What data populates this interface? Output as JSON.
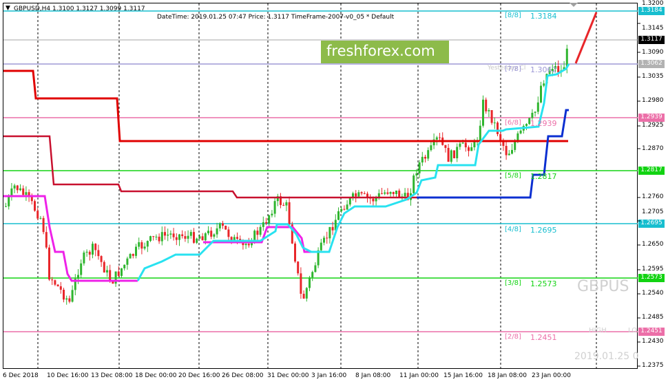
{
  "header": {
    "symbol_line": "GBPUSD,H4  1.3100 1.3127 1.3099 1.3117",
    "info_line": "DateTime: 2019.01.25 07:47    Price: 1.3117    TimeFrame-2007-v0_05    *    Default",
    "watermark": "freshforex.com",
    "pair_watermark": "GBPUS",
    "bottom_datetime": "2019.01.25 0",
    "high_label": "HIGH",
    "low_label": "LO",
    "yesterday_label": "Yesterday Cl"
  },
  "price_axis": {
    "ticks": [
      "1.3200",
      "1.3145",
      "1.3090",
      "1.3035",
      "1.2980",
      "1.2925",
      "1.2870",
      "1.2760",
      "1.2705",
      "1.2650",
      "1.2595",
      "1.2540",
      "1.2485",
      "1.2430",
      "1.2375"
    ],
    "current": "1.3117",
    "yesterday": "1.3062"
  },
  "time_axis": {
    "ticks": [
      "6 Dec 2018",
      "10 Dec 16:00",
      "13 Dec 08:00",
      "18 Dec 00:00",
      "20 Dec 16:00",
      "26 Dec 08:00",
      "31 Dec 00:00",
      "3 Jan 16:00",
      "8 Jan 08:00",
      "11 Jan 00:00",
      "15 Jan 16:00",
      "18 Jan 08:00",
      "23 Jan 00:00"
    ]
  },
  "murrey_levels": [
    {
      "label": "[8/8]",
      "value": "1.3184",
      "color": "#17becf"
    },
    {
      "label": "[7/8]",
      "value": "1.3062",
      "color": "#9d98d6"
    },
    {
      "label": "[6/8]",
      "value": "1.2939",
      "color": "#ec6fa8"
    },
    {
      "label": "[5/8]",
      "value": "1.2817",
      "color": "#12d312"
    },
    {
      "label": "[4/8]",
      "value": "1.2695",
      "color": "#17becf"
    },
    {
      "label": "[3/8]",
      "value": "1.2573",
      "color": "#12d312"
    },
    {
      "label": "[2/8]",
      "value": "1.2451",
      "color": "#ec6fa8"
    }
  ],
  "colors": {
    "bull": "#2fb52f",
    "bear": "#e8262a",
    "trail_red": "#e00000",
    "trail_dark_red": "#c8102e",
    "trail_cyan": "#28e2f0",
    "trail_blue": "#0b2fd1",
    "trail_magenta": "#ee22e8"
  }
}
